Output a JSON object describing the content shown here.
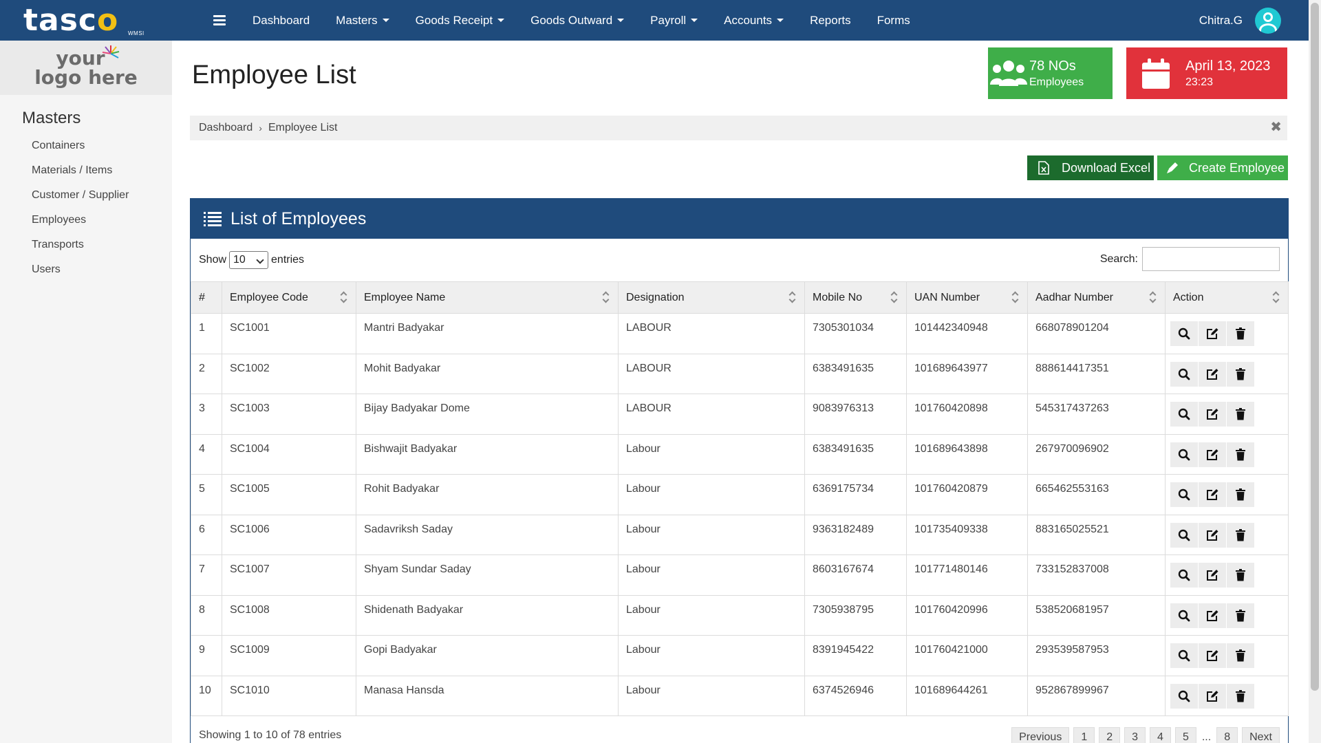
{
  "brand": {
    "name_pre": "tasc",
    "name_o": "o",
    "sub": "WMSI"
  },
  "nav": {
    "items": [
      {
        "label": "Dashboard",
        "dropdown": false
      },
      {
        "label": "Masters",
        "dropdown": true
      },
      {
        "label": "Goods Receipt",
        "dropdown": true
      },
      {
        "label": "Goods Outward",
        "dropdown": true
      },
      {
        "label": "Payroll",
        "dropdown": true
      },
      {
        "label": "Accounts",
        "dropdown": true
      },
      {
        "label": "Reports",
        "dropdown": false
      },
      {
        "label": "Forms",
        "dropdown": false
      }
    ],
    "user": "Chitra.G"
  },
  "sidebar": {
    "logo_line1": "your",
    "logo_line2": "logo here",
    "heading": "Masters",
    "items": [
      "Containers",
      "Materials / Items",
      "Customer / Supplier",
      "Employees",
      "Transports",
      "Users"
    ]
  },
  "page": {
    "title": "Employee List"
  },
  "stats": {
    "employees": {
      "main": "78 NOs",
      "sub": "Employees"
    },
    "date": {
      "main": "April 13, 2023",
      "sub": "23:23"
    }
  },
  "breadcrumb": {
    "home": "Dashboard",
    "current": "Employee List"
  },
  "buttons": {
    "download": "Download Excel",
    "create": "Create Employee"
  },
  "panel": {
    "title": "List of Employees",
    "show_label": "Show",
    "show_value": "10",
    "entries_label": "entries",
    "search_label": "Search:",
    "search_value": ""
  },
  "table": {
    "columns": [
      "#",
      "Employee Code",
      "Employee Name",
      "Designation",
      "Mobile No",
      "UAN Number",
      "Aadhar Number",
      "Action"
    ],
    "rows": [
      [
        "1",
        "SC1001",
        "Mantri Badyakar",
        "LABOUR",
        "7305301034",
        "101442340948",
        "668078901204"
      ],
      [
        "2",
        "SC1002",
        "Mohit Badyakar",
        "LABOUR",
        "6383491635",
        "101689643977",
        "888614417351"
      ],
      [
        "3",
        "SC1003",
        "Bijay Badyakar Dome",
        "LABOUR",
        "9083976313",
        "101760420898",
        "545317437263"
      ],
      [
        "4",
        "SC1004",
        "Bishwajit Badyakar",
        "Labour",
        "6383491635",
        "101689643898",
        "267970096902"
      ],
      [
        "5",
        "SC1005",
        "Rohit Badyakar",
        "Labour",
        "6369175734",
        "101760420879",
        "665462553163"
      ],
      [
        "6",
        "SC1006",
        "Sadavriksh Saday",
        "Labour",
        "9363182489",
        "101735409338",
        "883165025521"
      ],
      [
        "7",
        "SC1007",
        "Shyam Sundar Saday",
        "Labour",
        "8603167674",
        "101771480146",
        "733152837008"
      ],
      [
        "8",
        "SC1008",
        "Shidenath Badyakar",
        "Labour",
        "7305938795",
        "101760420996",
        "538520681957"
      ],
      [
        "9",
        "SC1009",
        "Gopi Badyakar",
        "Labour",
        "8391945422",
        "101760421000",
        "293539587953"
      ],
      [
        "10",
        "SC1010",
        "Manasa Hansda",
        "Labour",
        "6374526946",
        "101689644261",
        "952867899967"
      ]
    ]
  },
  "footer": {
    "info": "Showing 1 to 10 of 78 entries",
    "previous": "Previous",
    "pages": [
      "1",
      "2",
      "3",
      "4",
      "5"
    ],
    "ellipsis": "...",
    "last_page": "8",
    "next": "Next"
  },
  "colors": {
    "navbar": "#1f4b7c",
    "green": "#3fae49",
    "dark_green": "#1c6b2d",
    "red": "#e1323b",
    "brand_accent": "#f2c014"
  },
  "icons": {
    "menu": "hamburger-icon",
    "user": "user-avatar-icon",
    "employees": "users-group-icon",
    "date": "calendar-icon",
    "excel": "excel-file-icon",
    "create": "pencil-icon",
    "list": "list-icon",
    "view": "search-icon",
    "edit": "edit-icon",
    "delete": "trash-icon"
  }
}
